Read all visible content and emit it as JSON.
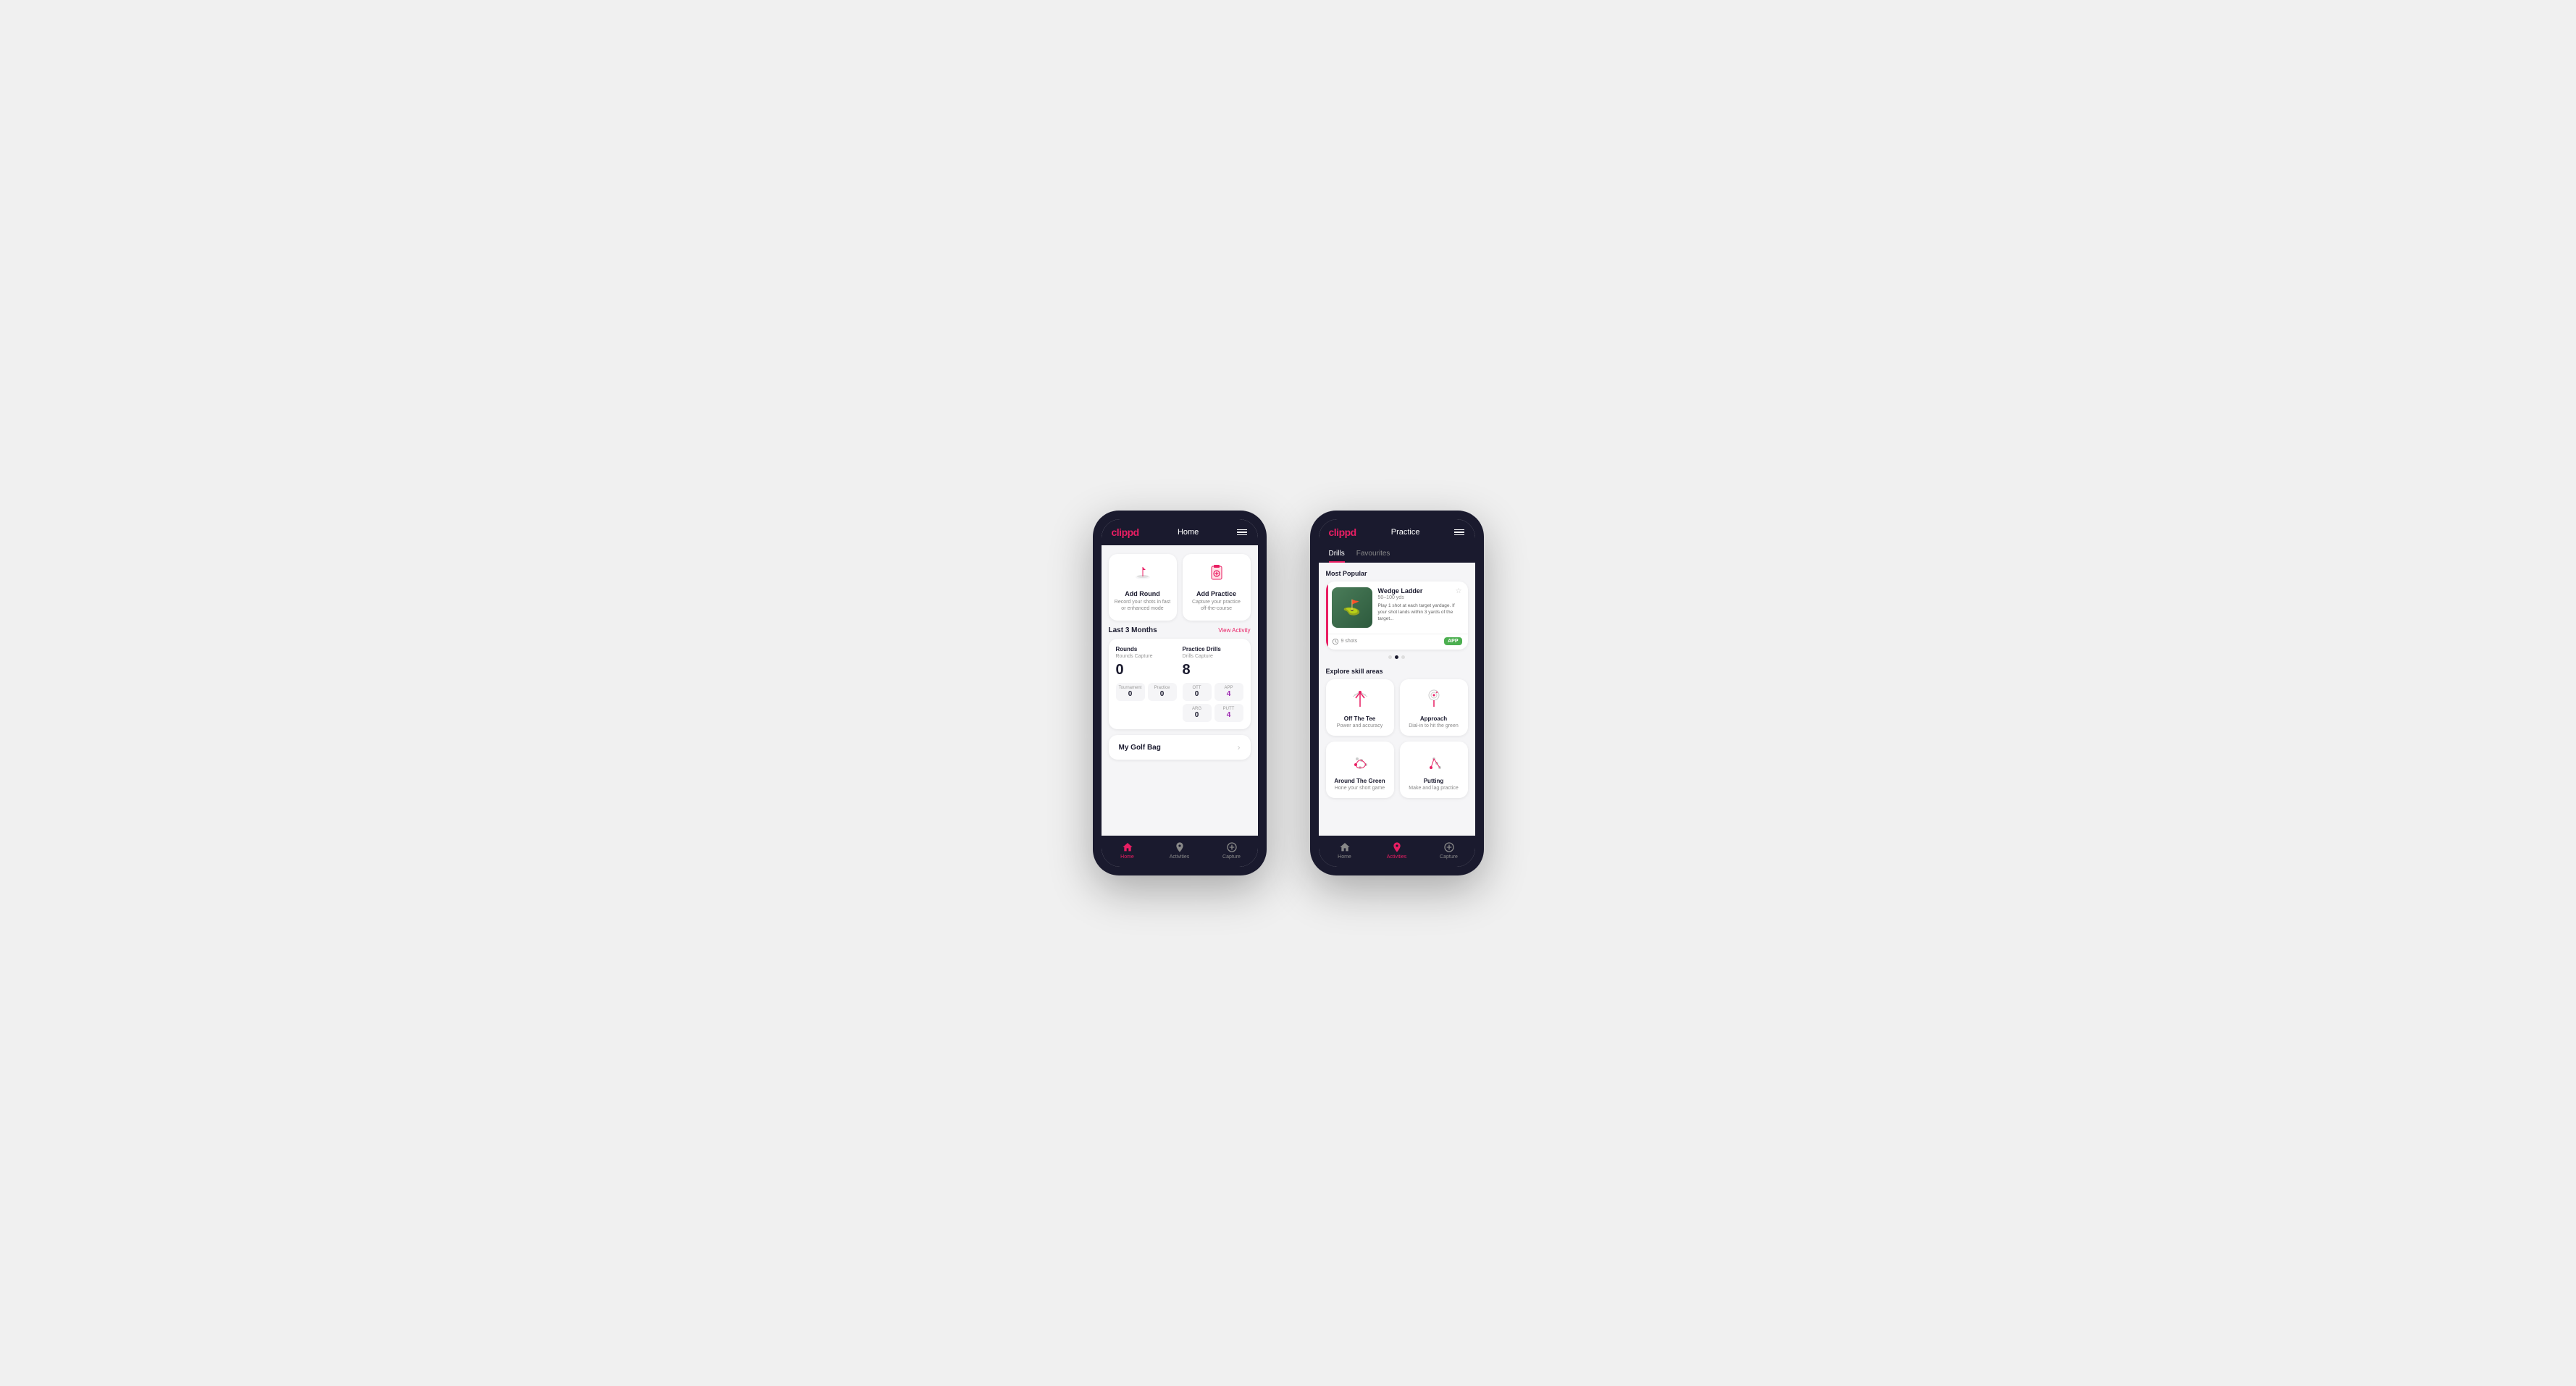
{
  "phone1": {
    "logo": "clippd",
    "header_title": "Home",
    "actions": [
      {
        "id": "add-round",
        "title": "Add Round",
        "desc": "Record your shots in fast or enhanced mode",
        "icon": "⛳"
      },
      {
        "id": "add-practice",
        "title": "Add Practice",
        "desc": "Capture your practice off-the-course",
        "icon": "📋"
      }
    ],
    "stats": {
      "period": "Last 3 Months",
      "view_link": "View Activity",
      "rounds": {
        "title": "Rounds",
        "capture_label": "Rounds Capture",
        "total": "0",
        "items": [
          {
            "label": "Tournament",
            "value": "0"
          },
          {
            "label": "Practice",
            "value": "0"
          }
        ]
      },
      "drills": {
        "title": "Practice Drills",
        "capture_label": "Drills Capture",
        "total": "8",
        "items": [
          {
            "label": "OTT",
            "value": "0"
          },
          {
            "label": "APP",
            "value": "4",
            "highlight": true
          },
          {
            "label": "ARG",
            "value": "0"
          },
          {
            "label": "PUTT",
            "value": "4",
            "highlight": true
          }
        ]
      }
    },
    "golf_bag": "My Golf Bag",
    "nav": [
      {
        "label": "Home",
        "icon": "🏠",
        "active": true
      },
      {
        "label": "Activities",
        "icon": "⛺",
        "active": false
      },
      {
        "label": "Capture",
        "icon": "➕",
        "active": false
      }
    ]
  },
  "phone2": {
    "logo": "clippd",
    "header_title": "Practice",
    "tabs": [
      {
        "label": "Drills",
        "active": true
      },
      {
        "label": "Favourites",
        "active": false
      }
    ],
    "most_popular_label": "Most Popular",
    "featured": {
      "title": "Wedge Ladder",
      "subtitle": "50–100 yds",
      "desc": "Play 1 shot at each target yardage. If your shot lands within 3 yards of the target...",
      "shots": "9 shots",
      "badge": "APP"
    },
    "dots": [
      false,
      true,
      false
    ],
    "explore_label": "Explore skill areas",
    "skills": [
      {
        "label": "Off The Tee",
        "sub": "Power and accuracy",
        "icon": "tee"
      },
      {
        "label": "Approach",
        "sub": "Dial-in to hit the green",
        "icon": "approach"
      },
      {
        "label": "Around The Green",
        "sub": "Hone your short game",
        "icon": "atg"
      },
      {
        "label": "Putting",
        "sub": "Make and lag practice",
        "icon": "putt"
      }
    ],
    "nav": [
      {
        "label": "Home",
        "icon": "🏠",
        "active": false
      },
      {
        "label": "Activities",
        "icon": "⛺",
        "active": true
      },
      {
        "label": "Capture",
        "icon": "➕",
        "active": false
      }
    ]
  }
}
